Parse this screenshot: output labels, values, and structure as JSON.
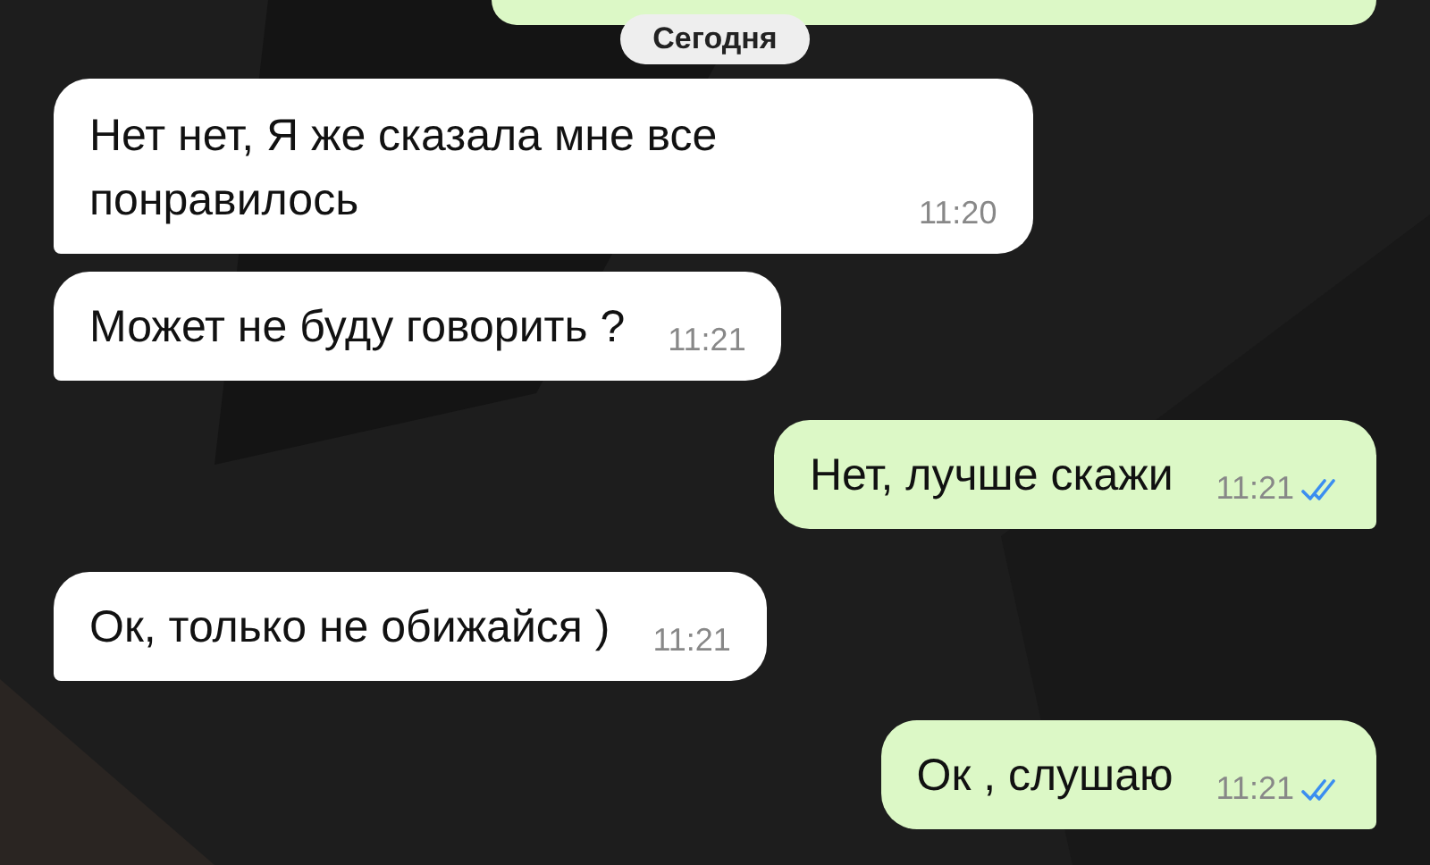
{
  "date_separator": "Сегодня",
  "messages": [
    {
      "kind": "incoming",
      "text": "Нет нет, Я же сказала мне все понравилось",
      "time": "11:20"
    },
    {
      "kind": "incoming",
      "text": "Может не буду говорить ?",
      "time": "11:21"
    },
    {
      "kind": "outgoing",
      "text": "Нет, лучше скажи",
      "time": "11:21",
      "read": true
    },
    {
      "kind": "incoming",
      "text": "Ок, только не обижайся )",
      "time": "11:21"
    },
    {
      "kind": "outgoing",
      "text": "Ок , слушаю",
      "time": "11:21",
      "read": true
    }
  ]
}
